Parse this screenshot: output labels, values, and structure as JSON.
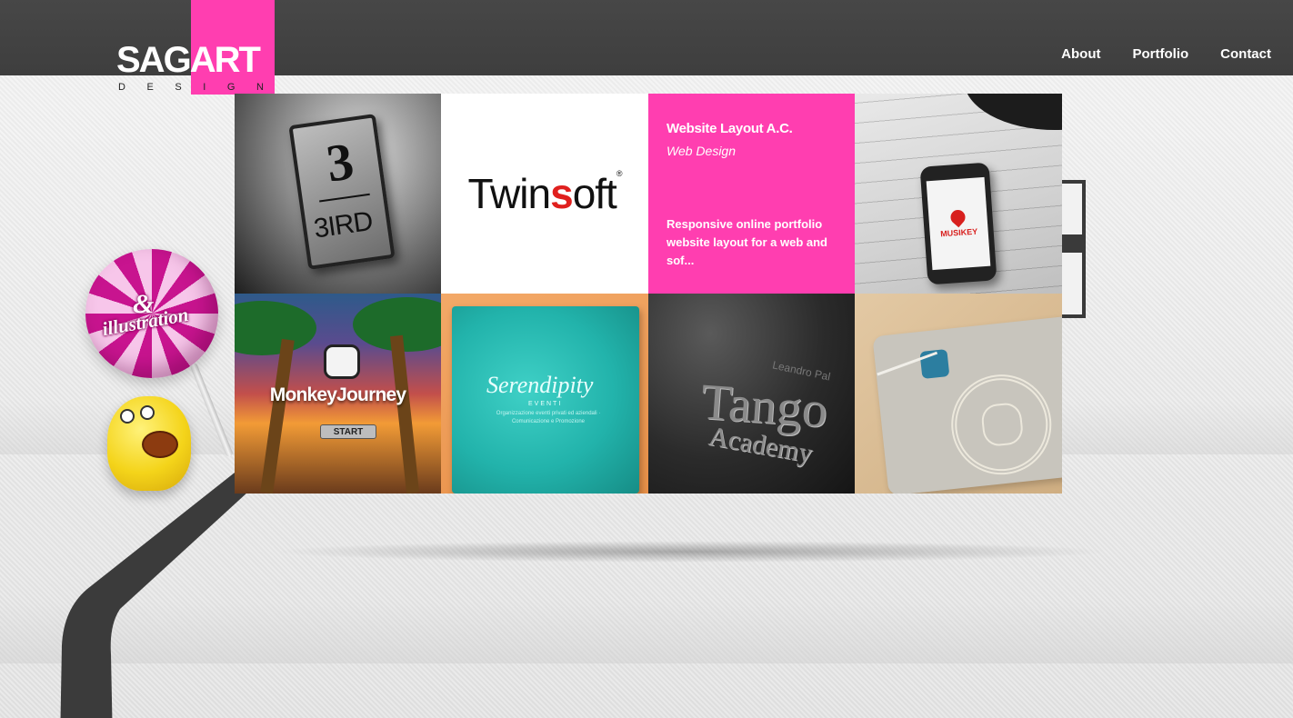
{
  "brand": {
    "logo_main_part1": "SAG",
    "logo_main_part2": "ART",
    "logo_sub_letters": [
      "D",
      "E",
      "S",
      "I",
      "G",
      "N"
    ],
    "accent_color": "#ff3eb0",
    "header_color": "#424242"
  },
  "nav": {
    "items": [
      {
        "label": "About"
      },
      {
        "label": "Portfolio"
      },
      {
        "label": "Contact"
      }
    ]
  },
  "decor": {
    "lollipop_amp": "&",
    "lollipop_label": "illustration"
  },
  "portfolio": {
    "tiles": [
      {
        "name": "3bird",
        "text_top": "3",
        "text_bottom": "3IRD"
      },
      {
        "name": "twinsoft",
        "text_a": "Twin",
        "text_s": "s",
        "text_b": "oft",
        "reg": "®"
      },
      {
        "name": "info",
        "title": "Website Layout A.C.",
        "category": "Web Design",
        "description": "Responsive online portfolio website layout for a web and sof..."
      },
      {
        "name": "musikey",
        "brand_a": "MUSI",
        "brand_b": "KEY"
      },
      {
        "name": "monkeyjourney",
        "title": "MonkeyJourney",
        "button": "START"
      },
      {
        "name": "serendipity",
        "script": "Serendipity",
        "sub": "EVENTI",
        "small": "Organizzazione eventi privati ed aziendali · Comunicazione e Promozione"
      },
      {
        "name": "tango",
        "line1": "Tango",
        "line2": "Academy",
        "line3": "Leandro Pal"
      },
      {
        "name": "lion-tag"
      }
    ]
  }
}
